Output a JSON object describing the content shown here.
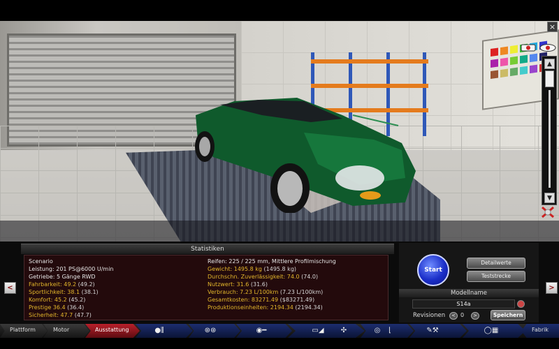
{
  "window": {
    "close_glyph": "×"
  },
  "viewport": {
    "scrollbar": {
      "up_glyph": "▲",
      "down_glyph": "▼"
    },
    "icons": [
      "camera-icon",
      "eye-icon",
      "tools-icon"
    ]
  },
  "statistics": {
    "title": "Statistiken",
    "left": [
      {
        "label": "Scenario",
        "value": "",
        "prev": "",
        "highlight": false
      },
      {
        "label": "Leistung:",
        "value": "201 PS@6000 U/min",
        "prev": "",
        "highlight": false
      },
      {
        "label": "Getriebe:",
        "value": "5 Gänge RWD",
        "prev": "",
        "highlight": false
      },
      {
        "label": "Fahrbarkeit:",
        "value": "49.2",
        "prev": "(49.2)",
        "highlight": true
      },
      {
        "label": "Sportlichkeit:",
        "value": "38.1",
        "prev": "(38.1)",
        "highlight": true
      },
      {
        "label": "Komfort:",
        "value": "45.2",
        "prev": "(45.2)",
        "highlight": true
      },
      {
        "label": "Prestige",
        "value": "36.4",
        "prev": "(36.4)",
        "highlight": true
      },
      {
        "label": "Sicherheit:",
        "value": "47.7",
        "prev": "(47.7)",
        "highlight": true
      }
    ],
    "right": [
      {
        "label": "Reifen:",
        "value": "225 / 225 mm, Mittlere Profilmischung",
        "prev": "",
        "highlight": false
      },
      {
        "label": "Gewicht:",
        "value": "1495.8 kg",
        "prev": "(1495.8 kg)",
        "highlight": true
      },
      {
        "label": "Durchschn. Zuverlässigkeit:",
        "value": "74.0",
        "prev": "(74.0)",
        "highlight": true
      },
      {
        "label": "Nutzwert:",
        "value": "31.6",
        "prev": "(31.6)",
        "highlight": true
      },
      {
        "label": "Verbrauch:",
        "value": "7.23 L/100km",
        "prev": "(7.23 L/100km)",
        "highlight": true
      },
      {
        "label": "Gesamtkosten:",
        "value": "83271.49",
        "prev": "($83271.49)",
        "highlight": true
      },
      {
        "label": "Produktionseinheiten:",
        "value": "2194.34",
        "prev": "(2194.34)",
        "highlight": true
      }
    ]
  },
  "controls": {
    "start_label": "Start",
    "detailwerte_label": "Detailwerte",
    "teststrecke_label": "Teststrecke",
    "modelname_label": "Modellname",
    "modelname_value": "S14a",
    "revisionen_label": "Revisionen",
    "revision_value": "0",
    "save_label": "Speichern",
    "prev_glyph": "<",
    "next_glyph": ">"
  },
  "nav": {
    "tabs": [
      {
        "label": "Plattform",
        "state": "normal"
      },
      {
        "label": "Motor",
        "state": "normal"
      },
      {
        "label": "Ausstattung",
        "state": "active"
      }
    ],
    "icon_tabs": [
      "engine-block-icon",
      "wheel-icon",
      "disc-brake-icon",
      "car-body-icon",
      "fan-icon",
      "steering-icon",
      "seat-icon",
      "tools-icon",
      "finish-flag-icon"
    ],
    "fabrik_label": "Fabrik"
  },
  "colors": {
    "accent_red": "#b8202a",
    "highlight_yellow": "#e3b62b",
    "start_blue": "#1b2fc9",
    "car_green": "#0f5a2c"
  }
}
